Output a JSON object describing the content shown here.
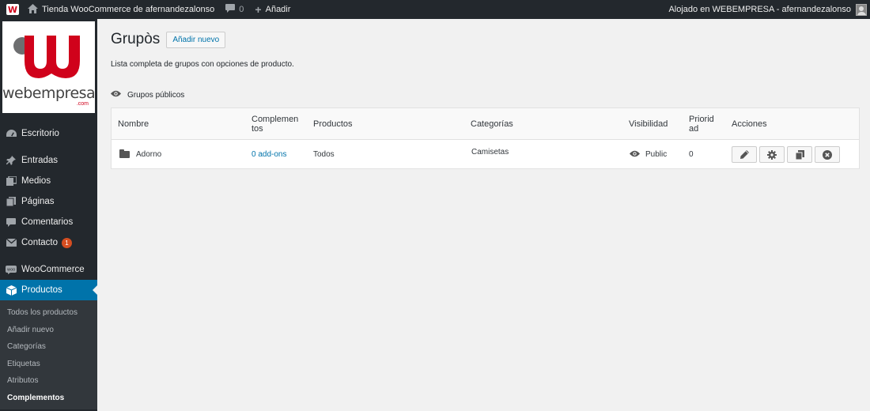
{
  "adminbar": {
    "site_name": "Tienda WooCommerce de afernandezalonso",
    "comments_count": "0",
    "add_label": "Añadir",
    "account_text": "Alojado en WEBEMPRESA - afernandezalonso",
    "logo_icon": "wp-logo-icon",
    "home_icon": "home-icon",
    "comment_icon": "comment-icon",
    "plus_icon": "plus-icon"
  },
  "brand": {
    "name": "webempresa",
    "suffix": ".com",
    "colors": {
      "red": "#d0021b",
      "grey": "#6d6e70"
    }
  },
  "sidebar": {
    "items": [
      {
        "label": "Escritorio",
        "icon": "dashboard-icon"
      },
      {
        "label": "Entradas",
        "icon": "pin-icon"
      },
      {
        "label": "Medios",
        "icon": "media-icon"
      },
      {
        "label": "Páginas",
        "icon": "pages-icon"
      },
      {
        "label": "Comentarios",
        "icon": "comment-icon"
      },
      {
        "label": "Contacto",
        "icon": "mail-icon",
        "badge": "1"
      },
      {
        "label": "WooCommerce",
        "icon": "woo-icon"
      },
      {
        "label": "Productos",
        "icon": "box-icon"
      }
    ],
    "submenu": [
      "Todos los productos",
      "Añadir nuevo",
      "Categorías",
      "Etiquetas",
      "Atributos",
      "Complementos"
    ]
  },
  "page": {
    "title": "Grupòs",
    "add_new": "Añadir nuevo",
    "description": "Lista completa de grupos con opciones de producto.",
    "section_title": "Grupos públicos"
  },
  "table": {
    "headers": {
      "nombre": "Nombre",
      "complementos": "Complemen tos",
      "productos": "Productos",
      "categorias": "Categorías",
      "visibilidad": "Visibilidad",
      "prioridad": "Priorid ad",
      "acciones": "Acciones"
    },
    "rows": [
      {
        "nombre": "Adorno",
        "complementos": "0 add-ons",
        "productos": "Todos",
        "categorias": "Camisetas",
        "visibilidad": "Public",
        "prioridad": "0"
      }
    ]
  },
  "colors": {
    "accent": "#0073aa",
    "adminbar": "#23282d",
    "badge": "#d54e21"
  }
}
